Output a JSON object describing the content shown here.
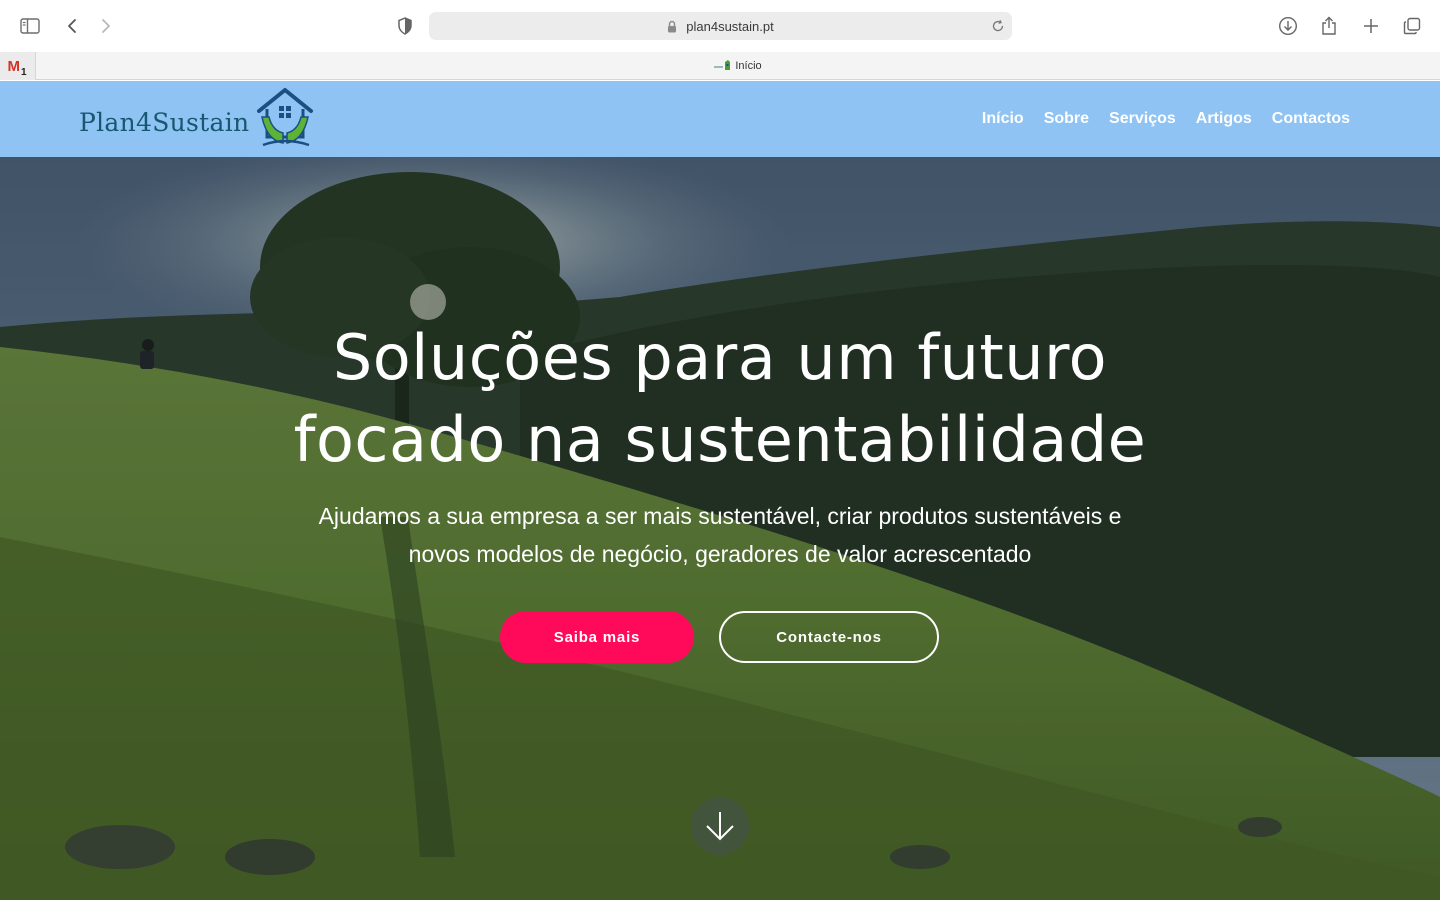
{
  "browser": {
    "url": "plan4sustain.pt",
    "pinned_tab": {
      "icon": "gmail-icon",
      "badge": "1"
    },
    "tab": {
      "title": "Início",
      "favicon": "plan4sustain-favicon"
    }
  },
  "site": {
    "logo_text": "Plan4Sustain",
    "nav": [
      "Início",
      "Sobre",
      "Serviços",
      "Artigos",
      "Contactos"
    ],
    "colors": {
      "header_bg": "#8ec3f4",
      "logo_text": "#17576f",
      "primary_button": "#ff0a5a"
    }
  },
  "hero": {
    "headline_line1": "Soluções para um futuro",
    "headline_line2": "focado na sustentabilidade",
    "subtitle_line1": "Ajudamos a sua empresa a ser mais sustentável, criar produtos sustentáveis e",
    "subtitle_line2": "novos modelos de negócio, geradores de valor acrescentado",
    "primary_button": "Saiba mais",
    "secondary_button": "Contacte-nos",
    "scroll_icon": "arrow-down-icon"
  }
}
